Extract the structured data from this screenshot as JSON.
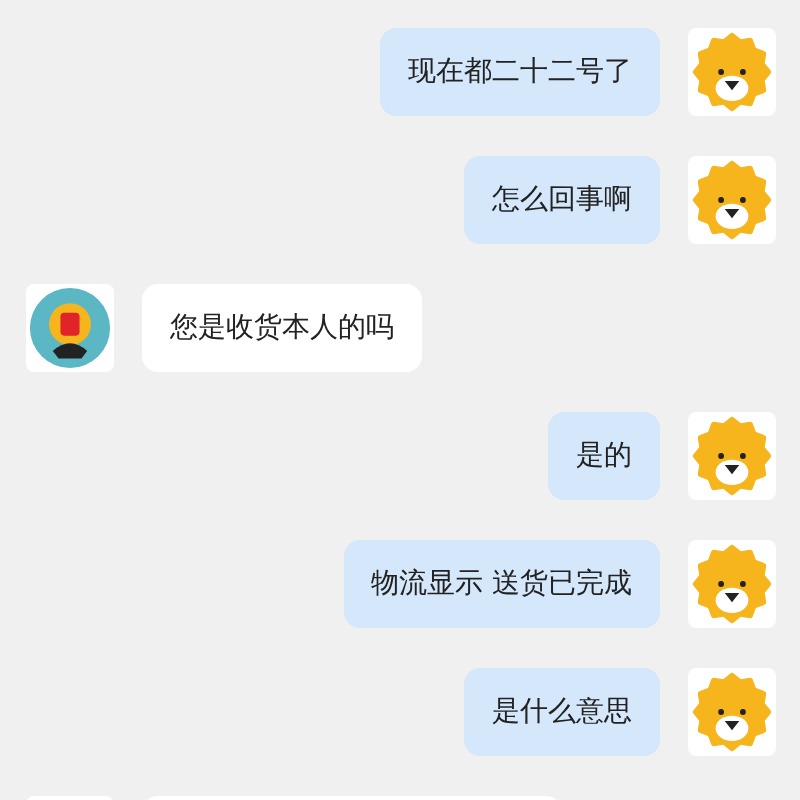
{
  "messages": [
    {
      "kind": "sent",
      "text": "现在都二十二号了"
    },
    {
      "kind": "sent",
      "text": "怎么回事啊"
    },
    {
      "kind": "received",
      "text": "您是收货本人的吗"
    },
    {
      "kind": "sent",
      "text": "是的"
    },
    {
      "kind": "sent",
      "text": "物流显示 送货已完成"
    },
    {
      "kind": "sent",
      "text": "是什么意思"
    },
    {
      "kind": "received"
    }
  ]
}
